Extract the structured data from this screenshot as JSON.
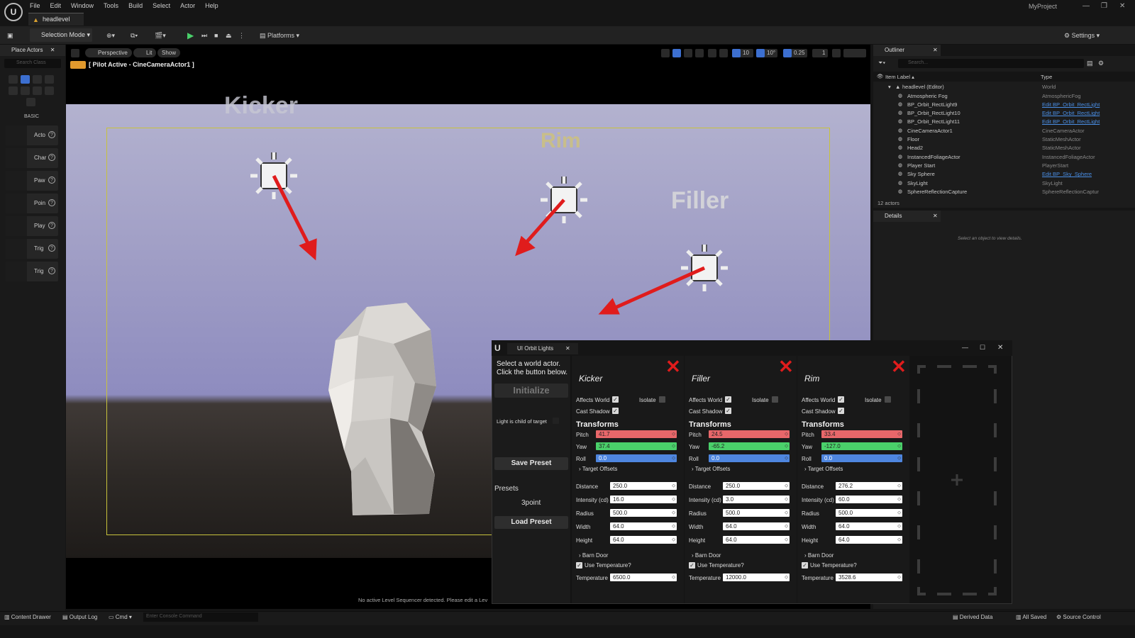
{
  "menu": {
    "items": [
      "File",
      "Edit",
      "Window",
      "Tools",
      "Build",
      "Select",
      "Actor",
      "Help"
    ],
    "project": "MyProject"
  },
  "level_tab": "headlevel",
  "toolbar": {
    "selection_mode": "Selection Mode",
    "platforms": "Platforms",
    "settings": "Settings"
  },
  "place_actors": {
    "title": "Place Actors",
    "search_placeholder": "Search Class",
    "section": "BASIC",
    "items": [
      "Acto",
      "Char",
      "Paw",
      "Poin",
      "Play",
      "Trig",
      "Trig"
    ]
  },
  "viewport": {
    "perspective": "Perspective",
    "lit": "Lit",
    "show": "Show",
    "pilot": "[ Pilot Active - CineCameraActor1 ]",
    "grid": "10",
    "angle": "10°",
    "scale": "0.25",
    "cam_speed": "1",
    "labels": {
      "kicker": "Kicker",
      "rim": "Rim",
      "filler": "Filler"
    },
    "sequencer_msg": "No active Level Sequencer detected. Please edit a Lev"
  },
  "outliner": {
    "title": "Outliner",
    "search_placeholder": "Search...",
    "col_label": "Item Label",
    "col_type": "Type",
    "root": {
      "label": "headlevel (Editor)",
      "type": "World"
    },
    "rows": [
      {
        "label": "Atmospheric Fog",
        "type": "AtmosphericFog",
        "link": false
      },
      {
        "label": "BP_Orbit_RectLight9",
        "type": "Edit BP_Orbit_RectLight",
        "link": true
      },
      {
        "label": "BP_Orbit_RectLight10",
        "type": "Edit BP_Orbit_RectLight",
        "link": true
      },
      {
        "label": "BP_Orbit_RectLight11",
        "type": "Edit BP_Orbit_RectLight",
        "link": true
      },
      {
        "label": "CineCameraActor1",
        "type": "CineCameraActor",
        "link": false
      },
      {
        "label": "Floor",
        "type": "StaticMeshActor",
        "link": false
      },
      {
        "label": "Head2",
        "type": "StaticMeshActor",
        "link": false
      },
      {
        "label": "InstancedFoliageActor",
        "type": "InstancedFoliageActor",
        "link": false
      },
      {
        "label": "Player Start",
        "type": "PlayerStart",
        "link": false
      },
      {
        "label": "Sky Sphere",
        "type": "Edit BP_Sky_Sphere",
        "link": true
      },
      {
        "label": "SkyLight",
        "type": "SkyLight",
        "link": false
      },
      {
        "label": "SphereReflectionCapture",
        "type": "SphereReflectionCaptur",
        "link": false
      }
    ],
    "count": "12 actors"
  },
  "details": {
    "title": "Details",
    "empty": "Select an object to view details."
  },
  "statusbar": {
    "content_drawer": "Content Drawer",
    "output_log": "Output Log",
    "cmd": "Cmd",
    "console_placeholder": "Enter Console Command",
    "derived": "Derived Data",
    "saved": "All Saved",
    "source": "Source Control"
  },
  "orbit_window": {
    "tab": "UI Orbit Lights",
    "instructions_1": "Select a world actor.",
    "instructions_2": "Click the button below.",
    "initialize": "Initialize",
    "child_label": "Light is child of target",
    "save_preset": "Save Preset",
    "presets_label": "Presets",
    "preset_name": "3point",
    "load_preset": "Load Preset",
    "labels": {
      "affects": "Affects World",
      "isolate": "Isolate",
      "cast": "Cast Shadow",
      "transforms": "Transforms",
      "pitch": "Pitch",
      "yaw": "Yaw",
      "roll": "Roll",
      "offsets": "Target Offsets",
      "distance": "Distance",
      "intensity": "Intensity (cd)",
      "radius": "Radius",
      "width": "Width",
      "height": "Height",
      "barn": "Barn Door",
      "usetemp": "Use Temperature?",
      "temp": "Temperature"
    },
    "lights": [
      {
        "name": "Kicker",
        "pitch": "41.7",
        "yaw": "37.4",
        "roll": "0.0",
        "distance": "250.0",
        "intensity": "16.0",
        "radius": "500.0",
        "width": "64.0",
        "height": "64.0",
        "temperature": "6500.0"
      },
      {
        "name": "Filler",
        "pitch": "24.5",
        "yaw": "-65.2",
        "roll": "0.0",
        "distance": "250.0",
        "intensity": "3.0",
        "radius": "500.0",
        "width": "64.0",
        "height": "64.0",
        "temperature": "12000.0"
      },
      {
        "name": "Rim",
        "pitch": "33.4",
        "yaw": "-127.0",
        "roll": "0.0",
        "distance": "276.2",
        "intensity": "60.0",
        "radius": "500.0",
        "width": "64.0",
        "height": "64.0",
        "temperature": "3528.6"
      }
    ]
  }
}
